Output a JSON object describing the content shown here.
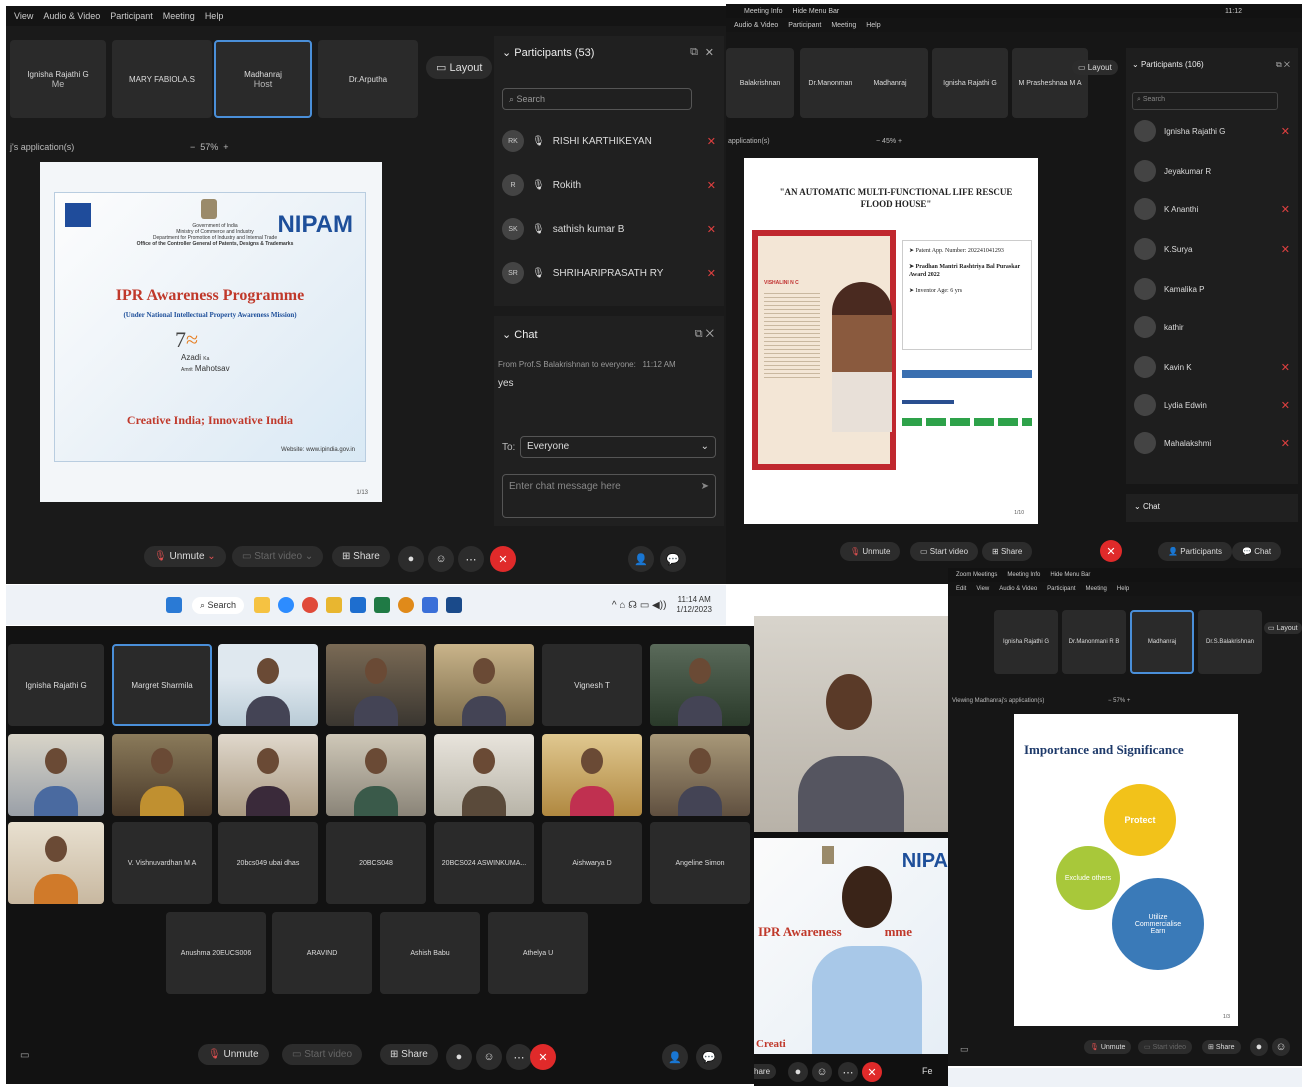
{
  "win1": {
    "menu": [
      "View",
      "Audio & Video",
      "Participant",
      "Meeting",
      "Help"
    ],
    "tiles": [
      {
        "name": "Ignisha Rajathi G",
        "sub": "Me"
      },
      {
        "name": "MARY FABIOLA.S",
        "sub": ""
      },
      {
        "name": "Madhanraj",
        "sub": "Host"
      },
      {
        "name": "Dr.Arputha",
        "sub": ""
      }
    ],
    "layout_label": "Layout",
    "viewing_label": "j's application(s)",
    "zoom": "57%",
    "slide": {
      "logo": "NIPAM",
      "gov_lines": [
        "Government of India",
        "Ministry of Commerce and Industry",
        "Department for Promotion of Industry and Internal Trade",
        "Office of the Controller General of Patents, Designs & Trademarks"
      ],
      "title": "IPR Awareness Programme",
      "subtitle": "(Under National Intellectual Property Awareness Mission)",
      "azadi_top": "Azadi",
      "azadi_ka": "Ka",
      "azadi_amrit": "Amrit",
      "azadi_bottom": "Mahotsav",
      "tagline": "Creative India; Innovative India",
      "website": "Website: www.ipindia.gov.in",
      "page": "1/13"
    },
    "participants": {
      "header": "Participants (53)",
      "search_placeholder": "Search",
      "list": [
        {
          "initials": "RK",
          "name": "RISHI KARTHIKEYAN"
        },
        {
          "initials": "R",
          "name": "Rokith"
        },
        {
          "initials": "SK",
          "name": "sathish kumar B"
        },
        {
          "initials": "SR",
          "name": "SHRIHARIPRASATH RY"
        }
      ]
    },
    "chat": {
      "header": "Chat",
      "message_meta": "From Prof.S Balakrishnan to everyone:",
      "message_time": "11:12 AM",
      "message_text": "yes",
      "to_label": "To:",
      "to_value": "Everyone",
      "input_placeholder": "Enter chat message here"
    },
    "toolbar": {
      "unmute": "Unmute",
      "start_video": "Start video",
      "share": "Share"
    }
  },
  "taskbar1": {
    "search": "Search",
    "time": "11:14 AM",
    "date": "1/12/2023"
  },
  "win2": {
    "menu": [
      "Meeting Info",
      "Hide Menu Bar"
    ],
    "submenu": [
      "Audio & Video",
      "Participant",
      "Meeting",
      "Help"
    ],
    "time": "11:12",
    "tiles": [
      "Balakrishnan",
      "Dr.Manonmani R B",
      "Madhanraj",
      "Ignisha Rajathi G",
      "M Prasheshnaa M A"
    ],
    "layout_label": "Layout",
    "viewing_label": "application(s)",
    "zoom": "45%",
    "slide": {
      "title": "\"AN AUTOMATIC MULTI-FUNCTIONAL LIFE RESCUE FLOOD HOUSE\"",
      "bullets": [
        "Patent App. Number: 202241041293",
        "Pradhan Mantri Rashtriya Bal Puraskar Award 2022",
        "Inventor Age: 6 yrs"
      ],
      "card_title": "VISHALINI N C",
      "page": "1/10"
    },
    "participants": {
      "header": "Participants (106)",
      "search_placeholder": "Search",
      "list": [
        "Ignisha Rajathi G",
        "Jeyakumar R",
        "K Ananthi",
        "K.Surya",
        "Kamalika P",
        "kathir",
        "Kavin K",
        "Lydia Edwin",
        "Mahalakshmi"
      ]
    },
    "chat_label": "Chat",
    "toolbar": {
      "unmute": "Unmute",
      "start_video": "Start video",
      "share": "Share",
      "participants": "Participants",
      "chat": "Chat"
    }
  },
  "win3": {
    "tiles_top": [
      "Ignisha Rajathi G",
      "Margret Sharmila",
      "",
      "",
      "",
      "Vignesh T",
      ""
    ],
    "names_row3": [
      "",
      "V. Vishnuvardhan M A",
      "20bcs049 ubai dhas",
      "20BCS048",
      "20BCS024 ASWINKUMA...",
      "Aishwarya D",
      "Angeline Simon"
    ],
    "names_row4": [
      "Anushma 20EUCS006",
      "ARAVIND",
      "Ashish Babu",
      "Athelya U"
    ],
    "toolbar": {
      "unmute": "Unmute",
      "start_video": "Start video",
      "share": "Share"
    }
  },
  "win4": {
    "menu": [
      "Zoom Meetings",
      "Meeting Info",
      "Hide Menu Bar"
    ],
    "submenu": [
      "Edit",
      "View",
      "Audio & Video",
      "Participant",
      "Meeting",
      "Help"
    ],
    "tiles": [
      "Ignisha Rajathi G",
      "Dr.Manonmani R B",
      "Madhanraj",
      "Dr.S.Balakrishnan"
    ],
    "layout_label": "Layout",
    "viewing_label": "Viewing Madhanraj's application(s)",
    "zoom": "57%",
    "slide": {
      "title": "Importance and Significance",
      "gear1": "Protect",
      "gear2": "Exclude others",
      "gear3": "Utilize Commercialise Earn",
      "page": "1/3"
    },
    "toolbar": {
      "unmute": "Unmute",
      "start_video": "Start video",
      "share": "Share"
    }
  },
  "presenter": {
    "slide_title_frag": "IPR Awareness",
    "slide_title_frag2": "mme",
    "logo_frag": "NIPA",
    "footer_frag": "Creati",
    "toolbar_share": "hare",
    "toolbar_share2": "Fe"
  },
  "colors": {
    "bg": "#1a1a1a",
    "accent": "#4a8fd9",
    "red": "#e02a2a"
  }
}
